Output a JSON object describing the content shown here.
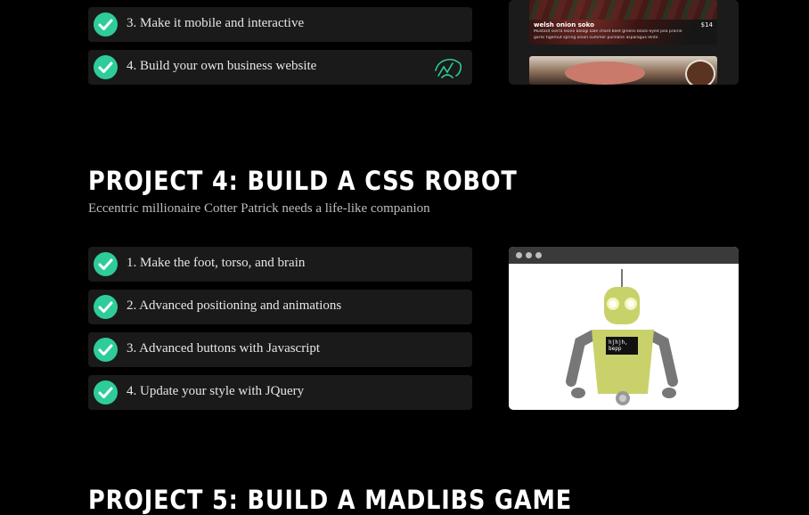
{
  "project3": {
    "tasks": [
      {
        "label": "3. Make it mobile and interactive"
      },
      {
        "label": "4. Build your own business website"
      }
    ],
    "preview": {
      "item_name": "welsh onion soko",
      "item_price": "$14",
      "item_desc_line1": "Mustard sierra leone bologi kale chard beet greens black-eyed pea prairie",
      "item_desc_line2": "garlic tigernut spring onion summer purslane asparagus lentil."
    }
  },
  "project4": {
    "title": "PROJECT 4: BUILD A CSS ROBOT",
    "subtitle": "Eccentric millionaire Cotter Patrick needs a life-like companion",
    "tasks": [
      {
        "label": "1. Make the foot, torso, and brain"
      },
      {
        "label": "2. Advanced positioning and animations"
      },
      {
        "label": "3. Advanced buttons with Javascript"
      },
      {
        "label": "4. Update your style with JQuery"
      }
    ],
    "robot_screen_text": "hjhjh, bepp"
  },
  "project5": {
    "title": "PROJECT 5: BUILD A MADLIBS GAME"
  },
  "colors": {
    "check": "#2ecc9a",
    "task_bg": "#1a1a1a",
    "robot_body": "#c9d16a"
  }
}
